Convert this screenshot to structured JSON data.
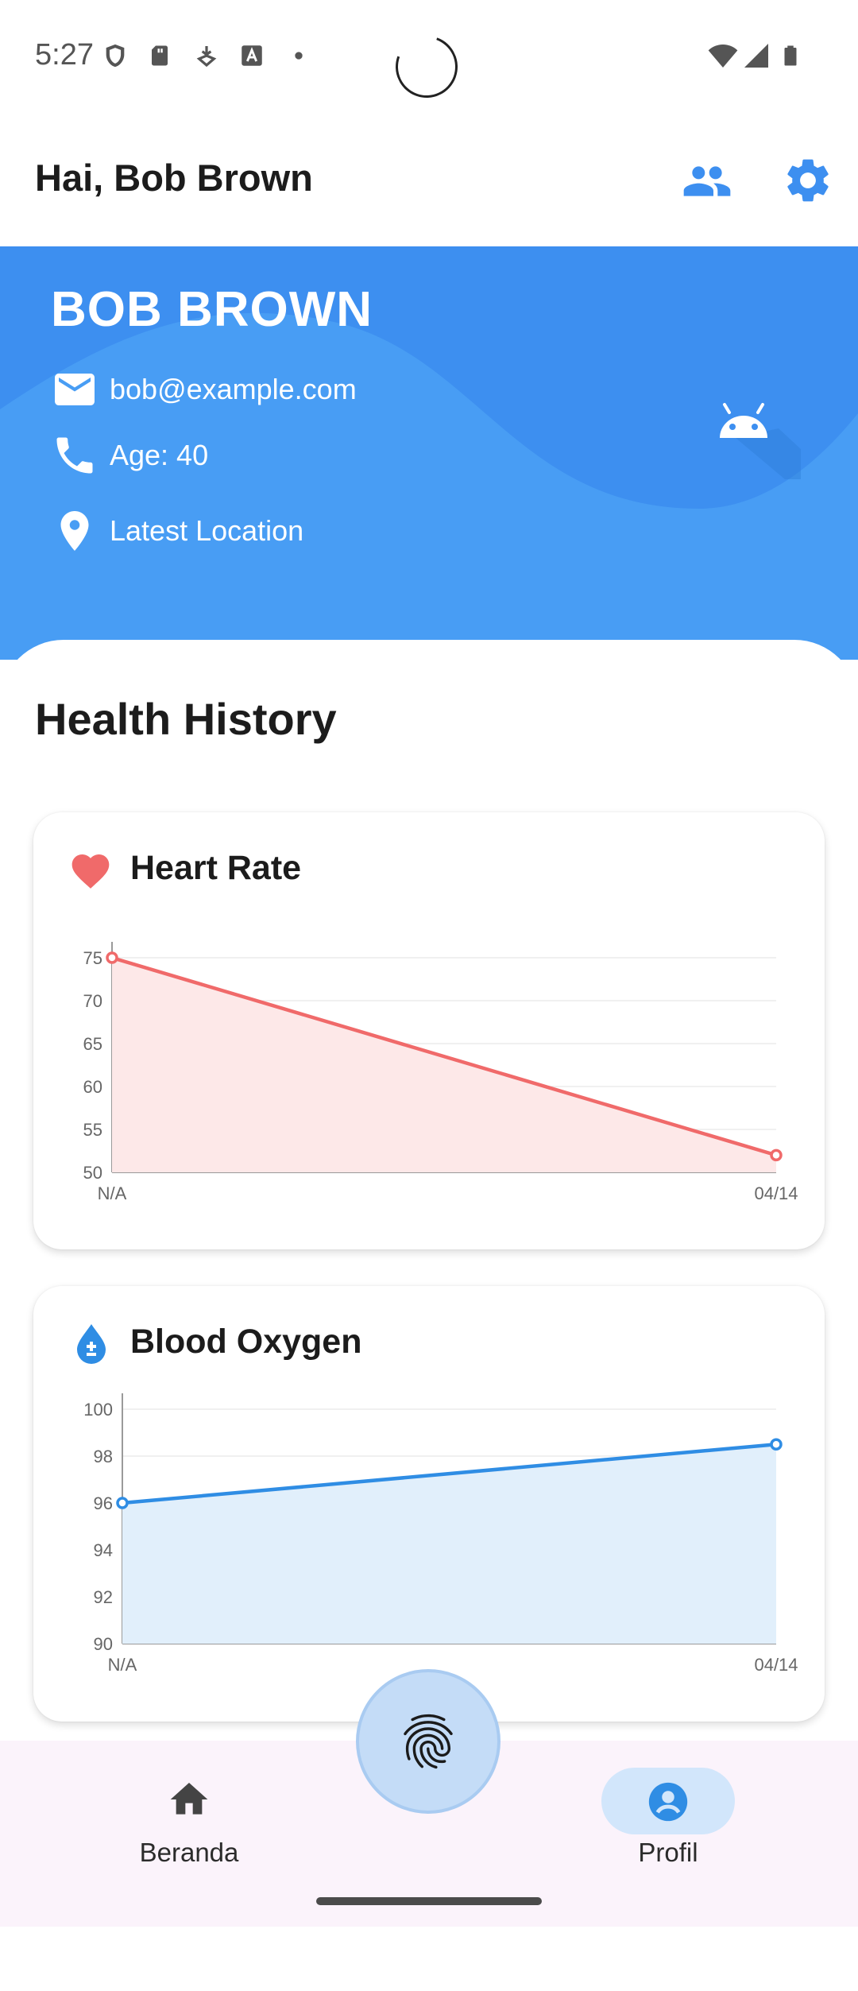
{
  "status_bar": {
    "time": "5:27",
    "left_icons": [
      "shield-icon",
      "sd-card-icon",
      "download-icon",
      "font-icon",
      "dot-icon"
    ],
    "right_icons": [
      "wifi-icon",
      "signal-icon",
      "battery-icon"
    ]
  },
  "app_bar": {
    "greeting": "Hai, Bob Brown",
    "actions": [
      "people-icon",
      "settings-icon"
    ]
  },
  "profile": {
    "name": "BOB BROWN",
    "email": "bob@example.com",
    "age": "Age: 40",
    "location": "Latest Location",
    "header_color": "#3d8ff0"
  },
  "health": {
    "title": "Health History",
    "heart_rate": {
      "title": "Heart Rate",
      "color": "#f06a6a"
    },
    "blood_oxygen": {
      "title": "Blood Oxygen",
      "color": "#2f8de4"
    }
  },
  "chart_data": [
    {
      "type": "area",
      "title": "Heart Rate",
      "x": [
        "N/A",
        "04/14"
      ],
      "series": [
        {
          "values": [
            75,
            52
          ]
        }
      ],
      "ylim": [
        50,
        75
      ],
      "yticks": [
        50,
        55,
        60,
        65,
        70,
        75
      ],
      "grid": true,
      "color": "#f06a6a",
      "fill": "#fde8e8"
    },
    {
      "type": "area",
      "title": "Blood Oxygen",
      "x": [
        "N/A",
        "04/14"
      ],
      "series": [
        {
          "values": [
            96,
            98.5
          ]
        }
      ],
      "ylim": [
        90,
        100
      ],
      "yticks": [
        90,
        92,
        94,
        96,
        98,
        100
      ],
      "grid": true,
      "color": "#2f8de4",
      "fill": "#e1effb"
    }
  ],
  "bottom_nav": {
    "items": [
      {
        "label": "Beranda",
        "icon": "home-icon",
        "selected": false
      },
      {
        "label": "Profil",
        "icon": "person-icon",
        "selected": true
      }
    ],
    "center_action": "fingerprint-icon"
  }
}
